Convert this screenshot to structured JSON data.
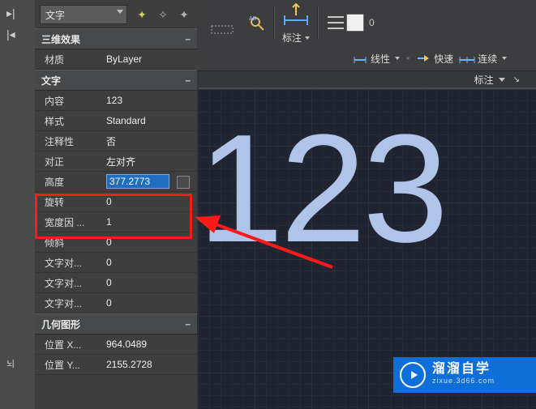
{
  "left_icons": {
    "pin_right": "▸|",
    "pin_left": "|◂",
    "handle": "뇌"
  },
  "combo": {
    "label": "文字"
  },
  "sections": {
    "fx3d": {
      "title": "三维效果"
    },
    "text": {
      "title": "文字"
    },
    "geom": {
      "title": "几何图形"
    }
  },
  "props_fx3d": {
    "material": {
      "label": "材质",
      "value": "ByLayer"
    }
  },
  "props_text": {
    "content": {
      "label": "内容",
      "value": "123"
    },
    "style": {
      "label": "样式",
      "value": "Standard"
    },
    "annot": {
      "label": "注释性",
      "value": "否"
    },
    "justify": {
      "label": "对正",
      "value": "左对齐"
    },
    "height": {
      "label": "高度",
      "value": "377.2773"
    },
    "rotation": {
      "label": "旋转",
      "value": "0"
    },
    "widthf": {
      "label": "宽度因 ...",
      "value": "1"
    },
    "oblique": {
      "label": "倾斜",
      "value": "0"
    },
    "align1": {
      "label": "文字对...",
      "value": "0"
    },
    "align2": {
      "label": "文字对...",
      "value": "0"
    },
    "align3": {
      "label": "文字对...",
      "value": "0"
    }
  },
  "props_geom": {
    "posx": {
      "label": "位置 X...",
      "value": "964.0489"
    },
    "posy": {
      "label": "位置 Y...",
      "value": "2155.2728"
    }
  },
  "ribbon": {
    "mark_label": "标注",
    "color_idx": "0",
    "linetype": "线性",
    "quick": "快速",
    "continue": "连续",
    "footer": "标注"
  },
  "viewport": {
    "cad_text": "123"
  },
  "watermark": {
    "title": "溜溜自学",
    "url": "zixue.3d66.com"
  }
}
